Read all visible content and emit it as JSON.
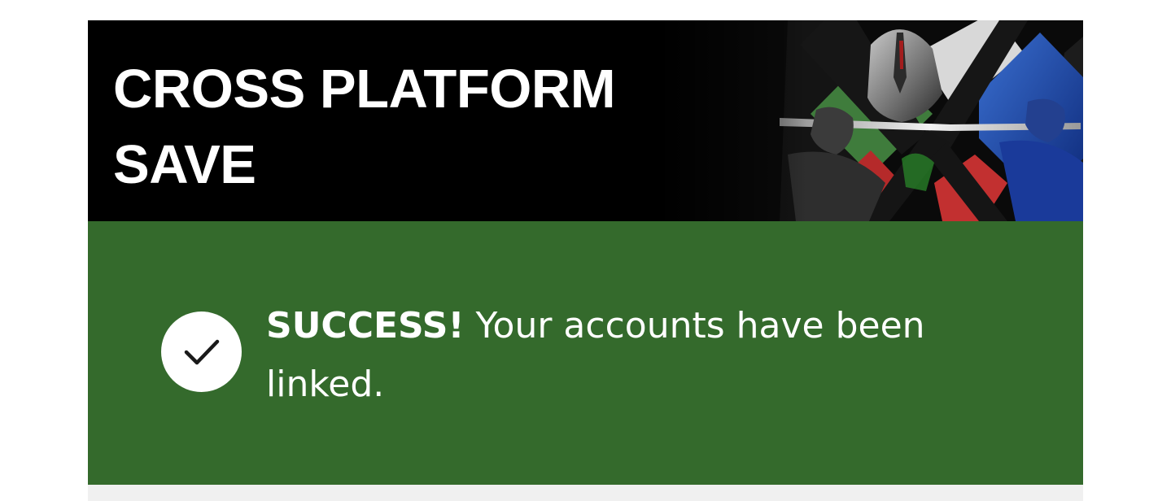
{
  "header": {
    "title_line1": "CROSS PLATFORM",
    "title_line2": "SAVE",
    "hero_image": "armored-warrior-with-sword-artwork"
  },
  "success": {
    "icon": "checkmark-icon",
    "strong_text": "SUCCESS!",
    "message_text": " Your accounts have been linked."
  },
  "colors": {
    "header_bg": "#000000",
    "success_bg": "#346a2c",
    "footer_bg": "#f0f0f0",
    "text": "#ffffff"
  }
}
